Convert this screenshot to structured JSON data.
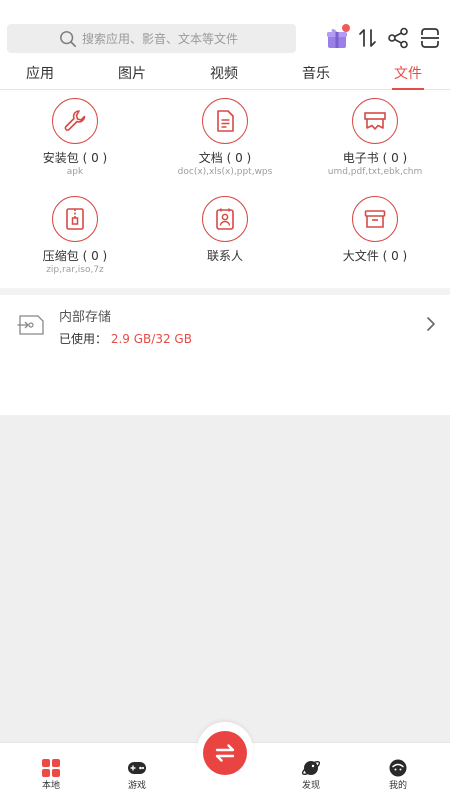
{
  "search": {
    "placeholder": "搜索应用、影音、文本等文件"
  },
  "tabs": [
    {
      "label": "应用",
      "active": false
    },
    {
      "label": "图片",
      "active": false
    },
    {
      "label": "视频",
      "active": false
    },
    {
      "label": "音乐",
      "active": false
    },
    {
      "label": "文件",
      "active": true
    }
  ],
  "categories": [
    {
      "label": "安装包 ( 0 )",
      "sub": "apk",
      "icon": "wrench-icon"
    },
    {
      "label": "文档 ( 0 )",
      "sub": "doc(x),xls(x),ppt,wps",
      "icon": "document-icon"
    },
    {
      "label": "电子书 ( 0 )",
      "sub": "umd,pdf,txt,ebk,chm",
      "icon": "ebook-icon"
    },
    {
      "label": "压缩包 ( 0 )",
      "sub": "zip,rar,iso,7z",
      "icon": "zip-icon"
    },
    {
      "label": "联系人",
      "sub": "",
      "icon": "contacts-icon"
    },
    {
      "label": "大文件 ( 0 )",
      "sub": "",
      "icon": "archive-box-icon"
    }
  ],
  "storage": {
    "title": "内部存储",
    "used_label": "已使用：",
    "used_value": "2.9 GB/32 GB"
  },
  "bottom_nav": [
    {
      "label": "本地",
      "icon": "grid-icon"
    },
    {
      "label": "游戏",
      "icon": "gamepad-icon"
    },
    {
      "label": "",
      "icon": "transfer-icon"
    },
    {
      "label": "发现",
      "icon": "planet-icon"
    },
    {
      "label": "我的",
      "icon": "profile-icon"
    }
  ],
  "colors": {
    "accent": "#e74c46",
    "icon_stroke": "#d64a46",
    "background": "#efeff0"
  }
}
